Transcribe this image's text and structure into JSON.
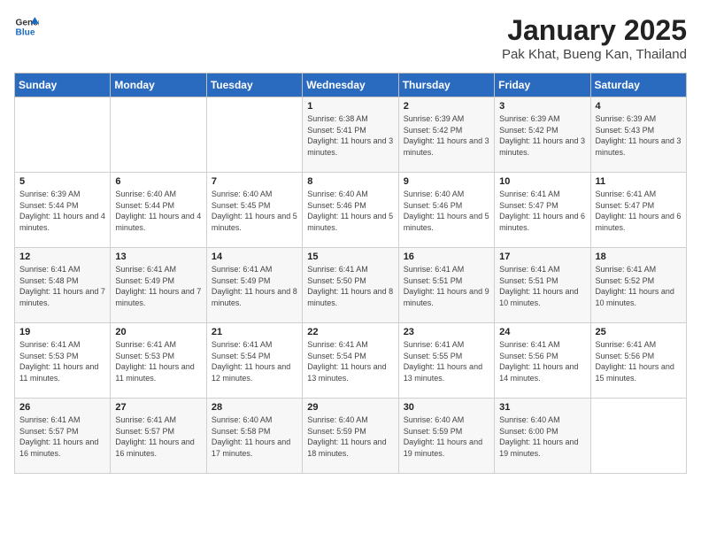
{
  "header": {
    "logo_general": "General",
    "logo_blue": "Blue",
    "month": "January 2025",
    "location": "Pak Khat, Bueng Kan, Thailand"
  },
  "days_of_week": [
    "Sunday",
    "Monday",
    "Tuesday",
    "Wednesday",
    "Thursday",
    "Friday",
    "Saturday"
  ],
  "weeks": [
    [
      {
        "day": "",
        "info": ""
      },
      {
        "day": "",
        "info": ""
      },
      {
        "day": "",
        "info": ""
      },
      {
        "day": "1",
        "info": "Sunrise: 6:38 AM\nSunset: 5:41 PM\nDaylight: 11 hours and 3 minutes."
      },
      {
        "day": "2",
        "info": "Sunrise: 6:39 AM\nSunset: 5:42 PM\nDaylight: 11 hours and 3 minutes."
      },
      {
        "day": "3",
        "info": "Sunrise: 6:39 AM\nSunset: 5:42 PM\nDaylight: 11 hours and 3 minutes."
      },
      {
        "day": "4",
        "info": "Sunrise: 6:39 AM\nSunset: 5:43 PM\nDaylight: 11 hours and 3 minutes."
      }
    ],
    [
      {
        "day": "5",
        "info": "Sunrise: 6:39 AM\nSunset: 5:44 PM\nDaylight: 11 hours and 4 minutes."
      },
      {
        "day": "6",
        "info": "Sunrise: 6:40 AM\nSunset: 5:44 PM\nDaylight: 11 hours and 4 minutes."
      },
      {
        "day": "7",
        "info": "Sunrise: 6:40 AM\nSunset: 5:45 PM\nDaylight: 11 hours and 5 minutes."
      },
      {
        "day": "8",
        "info": "Sunrise: 6:40 AM\nSunset: 5:46 PM\nDaylight: 11 hours and 5 minutes."
      },
      {
        "day": "9",
        "info": "Sunrise: 6:40 AM\nSunset: 5:46 PM\nDaylight: 11 hours and 5 minutes."
      },
      {
        "day": "10",
        "info": "Sunrise: 6:41 AM\nSunset: 5:47 PM\nDaylight: 11 hours and 6 minutes."
      },
      {
        "day": "11",
        "info": "Sunrise: 6:41 AM\nSunset: 5:47 PM\nDaylight: 11 hours and 6 minutes."
      }
    ],
    [
      {
        "day": "12",
        "info": "Sunrise: 6:41 AM\nSunset: 5:48 PM\nDaylight: 11 hours and 7 minutes."
      },
      {
        "day": "13",
        "info": "Sunrise: 6:41 AM\nSunset: 5:49 PM\nDaylight: 11 hours and 7 minutes."
      },
      {
        "day": "14",
        "info": "Sunrise: 6:41 AM\nSunset: 5:49 PM\nDaylight: 11 hours and 8 minutes."
      },
      {
        "day": "15",
        "info": "Sunrise: 6:41 AM\nSunset: 5:50 PM\nDaylight: 11 hours and 8 minutes."
      },
      {
        "day": "16",
        "info": "Sunrise: 6:41 AM\nSunset: 5:51 PM\nDaylight: 11 hours and 9 minutes."
      },
      {
        "day": "17",
        "info": "Sunrise: 6:41 AM\nSunset: 5:51 PM\nDaylight: 11 hours and 10 minutes."
      },
      {
        "day": "18",
        "info": "Sunrise: 6:41 AM\nSunset: 5:52 PM\nDaylight: 11 hours and 10 minutes."
      }
    ],
    [
      {
        "day": "19",
        "info": "Sunrise: 6:41 AM\nSunset: 5:53 PM\nDaylight: 11 hours and 11 minutes."
      },
      {
        "day": "20",
        "info": "Sunrise: 6:41 AM\nSunset: 5:53 PM\nDaylight: 11 hours and 11 minutes."
      },
      {
        "day": "21",
        "info": "Sunrise: 6:41 AM\nSunset: 5:54 PM\nDaylight: 11 hours and 12 minutes."
      },
      {
        "day": "22",
        "info": "Sunrise: 6:41 AM\nSunset: 5:54 PM\nDaylight: 11 hours and 13 minutes."
      },
      {
        "day": "23",
        "info": "Sunrise: 6:41 AM\nSunset: 5:55 PM\nDaylight: 11 hours and 13 minutes."
      },
      {
        "day": "24",
        "info": "Sunrise: 6:41 AM\nSunset: 5:56 PM\nDaylight: 11 hours and 14 minutes."
      },
      {
        "day": "25",
        "info": "Sunrise: 6:41 AM\nSunset: 5:56 PM\nDaylight: 11 hours and 15 minutes."
      }
    ],
    [
      {
        "day": "26",
        "info": "Sunrise: 6:41 AM\nSunset: 5:57 PM\nDaylight: 11 hours and 16 minutes."
      },
      {
        "day": "27",
        "info": "Sunrise: 6:41 AM\nSunset: 5:57 PM\nDaylight: 11 hours and 16 minutes."
      },
      {
        "day": "28",
        "info": "Sunrise: 6:40 AM\nSunset: 5:58 PM\nDaylight: 11 hours and 17 minutes."
      },
      {
        "day": "29",
        "info": "Sunrise: 6:40 AM\nSunset: 5:59 PM\nDaylight: 11 hours and 18 minutes."
      },
      {
        "day": "30",
        "info": "Sunrise: 6:40 AM\nSunset: 5:59 PM\nDaylight: 11 hours and 19 minutes."
      },
      {
        "day": "31",
        "info": "Sunrise: 6:40 AM\nSunset: 6:00 PM\nDaylight: 11 hours and 19 minutes."
      },
      {
        "day": "",
        "info": ""
      }
    ]
  ]
}
